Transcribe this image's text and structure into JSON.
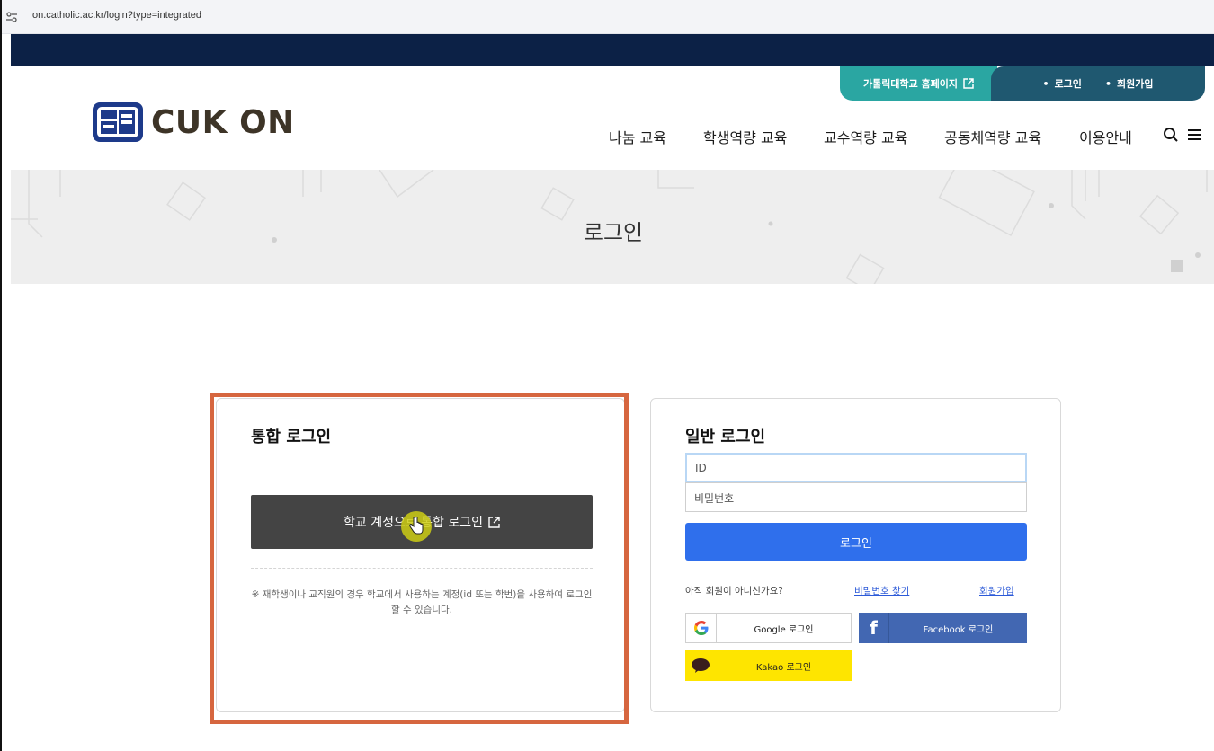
{
  "browser": {
    "url": "on.catholic.ac.kr/login?type=integrated"
  },
  "topbar": {
    "homepage_label": "가톨릭대학교 홈페이지",
    "login_label": "로그인",
    "signup_label": "회원가입"
  },
  "logo": {
    "name": "CUK ON"
  },
  "gnb": [
    "나눔 교육",
    "학생역량 교육",
    "교수역량 교육",
    "공동체역량 교육",
    "이용안내"
  ],
  "hero": {
    "title": "로그인"
  },
  "integrated": {
    "title": "통합 로그인",
    "button_label": "학교 계정으로 통합 로그인",
    "note": "※ 재학생이나 교직원의 경우 학교에서 사용하는 계정(id 또는 학번)을 사용하여 로그인할 수 있습니다."
  },
  "general": {
    "title": "일반 로그인",
    "id_placeholder": "ID",
    "password_placeholder": "비밀번호",
    "login_button": "로그인",
    "not_member": "아직 회원이 아니신가요?",
    "find_password": "비밀번호 찾기",
    "signup": "회원가입",
    "google_label": "Google 로그인",
    "facebook_label": "Facebook 로그인",
    "kakao_label": "Kakao 로그인"
  },
  "colors": {
    "navy": "#0c2146",
    "teal": "#2aa6a2",
    "auth_bg": "#1f5870",
    "login_blue": "#2f6fec",
    "kakao": "#fee500",
    "facebook": "#4267b2",
    "highlight": "#d6663f"
  }
}
